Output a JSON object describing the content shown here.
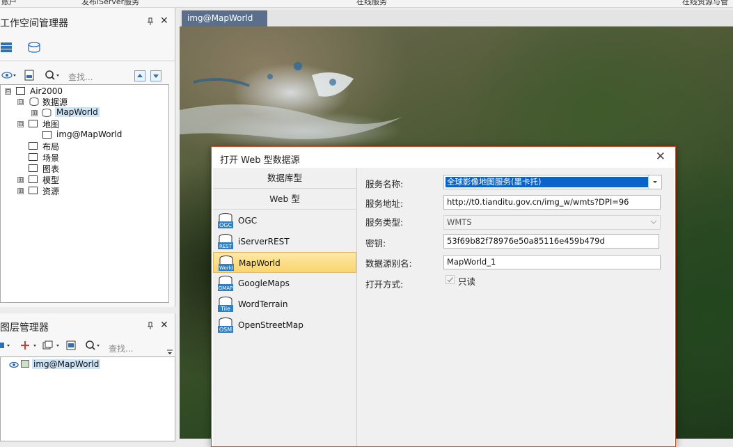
{
  "topmenu": {
    "items": [
      "账户",
      "发布iServer服务",
      "在线服务",
      "在线资源与管"
    ]
  },
  "workspace_panel": {
    "title": "工作空间管理器",
    "pin": "ᵖ",
    "close": "✕",
    "search_placeholder": "查找...",
    "tree": [
      {
        "label": "Air2000",
        "level": 0,
        "expand": "⊟"
      },
      {
        "label": "数据源",
        "level": 1,
        "expand": "⊟"
      },
      {
        "label": "MapWorld",
        "level": 2,
        "expand": "⊞",
        "selected": true
      },
      {
        "label": "地图",
        "level": 1,
        "expand": "⊟"
      },
      {
        "label": "img@MapWorld",
        "level": 2,
        "expand": ""
      },
      {
        "label": "布局",
        "level": 1,
        "expand": ""
      },
      {
        "label": "场景",
        "level": 1,
        "expand": ""
      },
      {
        "label": "图表",
        "level": 1,
        "expand": ""
      },
      {
        "label": "模型",
        "level": 1,
        "expand": "⊞"
      },
      {
        "label": "资源",
        "level": 1,
        "expand": "⊞"
      }
    ]
  },
  "layer_panel": {
    "title": "图层管理器",
    "search_placeholder": "查找...",
    "layers": [
      {
        "label": "img@MapWorld",
        "visible": true
      }
    ]
  },
  "map": {
    "tab_label": "img@MapWorld"
  },
  "dialog": {
    "title": "打开 Web 型数据源",
    "close": "✕",
    "left": {
      "db_type_label": "数据库型",
      "web_type_label": "Web 型",
      "items": [
        {
          "label": "OGC",
          "icon": "ogc-icon",
          "badge": "OGC"
        },
        {
          "label": "iServerREST",
          "icon": "rest-icon",
          "badge": "REST"
        },
        {
          "label": "MapWorld",
          "icon": "world-icon",
          "badge": "World",
          "selected": true
        },
        {
          "label": "GoogleMaps",
          "icon": "gmap-icon",
          "badge": "GMAP"
        },
        {
          "label": "WordTerrain",
          "icon": "tile-icon",
          "badge": "Tile"
        },
        {
          "label": "OpenStreetMap",
          "icon": "osm-icon",
          "badge": "OSM"
        }
      ]
    },
    "form": {
      "service_name_label": "服务名称:",
      "service_name_value": "全球影像地图服务(墨卡托)",
      "service_url_label": "服务地址:",
      "service_url_value": "http://t0.tianditu.gov.cn/img_w/wmts?DPI=96",
      "service_type_label": "服务类型:",
      "service_type_value": "WMTS",
      "key_label": "密钥:",
      "key_value": "53f69b82f78976e50a85116e459b479d",
      "alias_label": "数据源别名:",
      "alias_value": "MapWorld_1",
      "open_mode_label": "打开方式:",
      "readonly_label": "只读",
      "readonly_checked": true
    }
  },
  "colors": {
    "accent": "#c94f2c",
    "tab": "#5b6f8c",
    "selection": "#cce4f7",
    "highlight": "#fbd46c"
  }
}
